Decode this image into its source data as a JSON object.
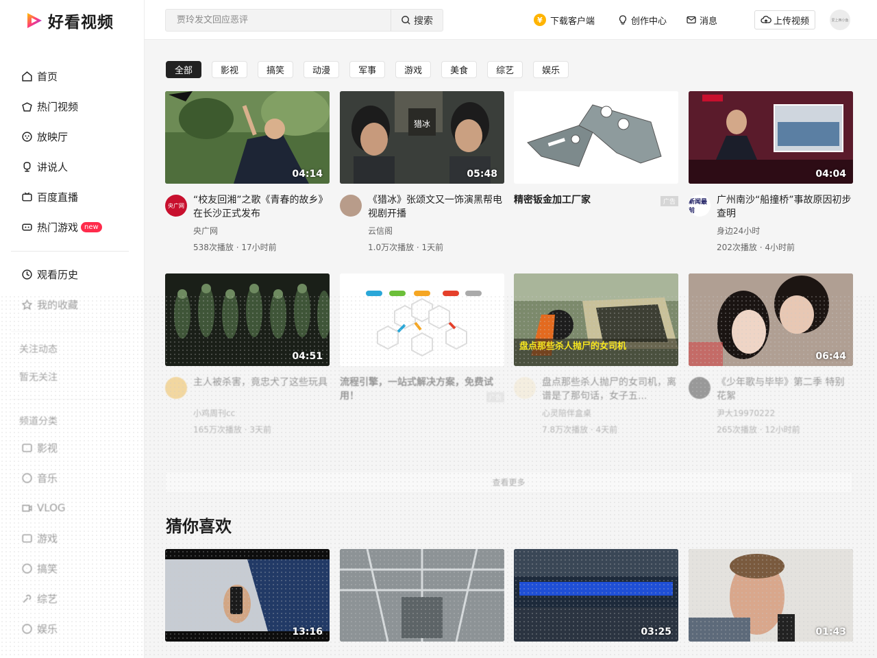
{
  "brand": {
    "name": "好看视频"
  },
  "header": {
    "search_placeholder": "贾玲发文回应恶评",
    "search_button": "搜索",
    "download_client": "下载客户端",
    "creator_center": "创作中心",
    "messages": "消息",
    "upload": "上传视频",
    "avatar_text": "爱上西小鱼"
  },
  "sidebar": {
    "nav": [
      {
        "label": "首页",
        "icon": "home-icon"
      },
      {
        "label": "热门视频",
        "icon": "hot-icon"
      },
      {
        "label": "放映厅",
        "icon": "film-icon"
      },
      {
        "label": "讲说人",
        "icon": "speaker-icon"
      },
      {
        "label": "百度直播",
        "icon": "live-icon"
      },
      {
        "label": "热门游戏",
        "icon": "game-icon",
        "badge": "new"
      }
    ],
    "secondary": [
      {
        "label": "观看历史",
        "icon": "clock-icon"
      },
      {
        "label": "我的收藏",
        "icon": "star-icon"
      }
    ],
    "follow_title": "关注动态",
    "follow_empty": "暂无关注",
    "category_title": "频道分类",
    "categories": [
      {
        "label": "影视",
        "icon": "tv-icon"
      },
      {
        "label": "音乐",
        "icon": "music-icon"
      },
      {
        "label": "VLOG",
        "icon": "vlog-icon"
      },
      {
        "label": "游戏",
        "icon": "gamepad-icon"
      },
      {
        "label": "搞笑",
        "icon": "smile-icon"
      },
      {
        "label": "综艺",
        "icon": "mic-icon"
      },
      {
        "label": "娱乐",
        "icon": "star2-icon"
      }
    ]
  },
  "tags": [
    "全部",
    "影视",
    "搞笑",
    "动漫",
    "军事",
    "游戏",
    "美食",
    "综艺",
    "娱乐"
  ],
  "videos_row1": [
    {
      "title": "“校友回湘”之歌《青春的故乡》在长沙正式发布",
      "channel": "央广网",
      "stats": "538次播放 · 17小时前",
      "duration": "04:14",
      "avatar_text": "央广网"
    },
    {
      "title": "《猎冰》张颂文又一饰演黑帮电视剧开播",
      "channel": "云信阁",
      "stats": "1.0万次播放 · 1天前",
      "duration": "05:48",
      "avatar_text": ""
    },
    {
      "title": "精密钣金加工厂家",
      "channel": "",
      "stats": "",
      "duration": "",
      "ad": "广告"
    },
    {
      "title": "广州南沙“船撞桥”事故原因初步查明",
      "channel": "身边24小时",
      "stats": "202次播放 · 4小时前",
      "duration": "04:04",
      "avatar_text": "新闻最前"
    }
  ],
  "videos_row2": [
    {
      "title": "主人被杀害，竟忠犬了这些玩具",
      "channel": "小鸡周刊cc",
      "stats": "165万次播放 · 3天前",
      "duration": "04:51"
    },
    {
      "title": "流程引擎，一站式解决方案，免费试用！",
      "channel": "",
      "stats": "",
      "duration": "",
      "ad": "广告"
    },
    {
      "title": "盘点那些杀人抛尸的女司机，离谱是了那句话，女子五...",
      "channel": "心灵陪伴盒桌",
      "stats": "7.8万次播放 · 4天前",
      "duration": ""
    },
    {
      "title": "《少年歌与毕毕》第二季 特别花絮",
      "channel": "尹大19970222",
      "stats": "265次播放 · 12小时前",
      "duration": "06:44"
    }
  ],
  "more_button": "查看更多",
  "section_title": "猜你喜欢",
  "videos_row3": [
    {
      "duration": "13:16"
    },
    {
      "duration": ""
    },
    {
      "duration": "03:25"
    },
    {
      "duration": "01:43"
    }
  ],
  "colors": {
    "accent": "#ff2b4b",
    "coin": "#ffb400",
    "brand_gradient": [
      "#ff3b7a",
      "#7a3cff",
      "#ffc400"
    ]
  }
}
